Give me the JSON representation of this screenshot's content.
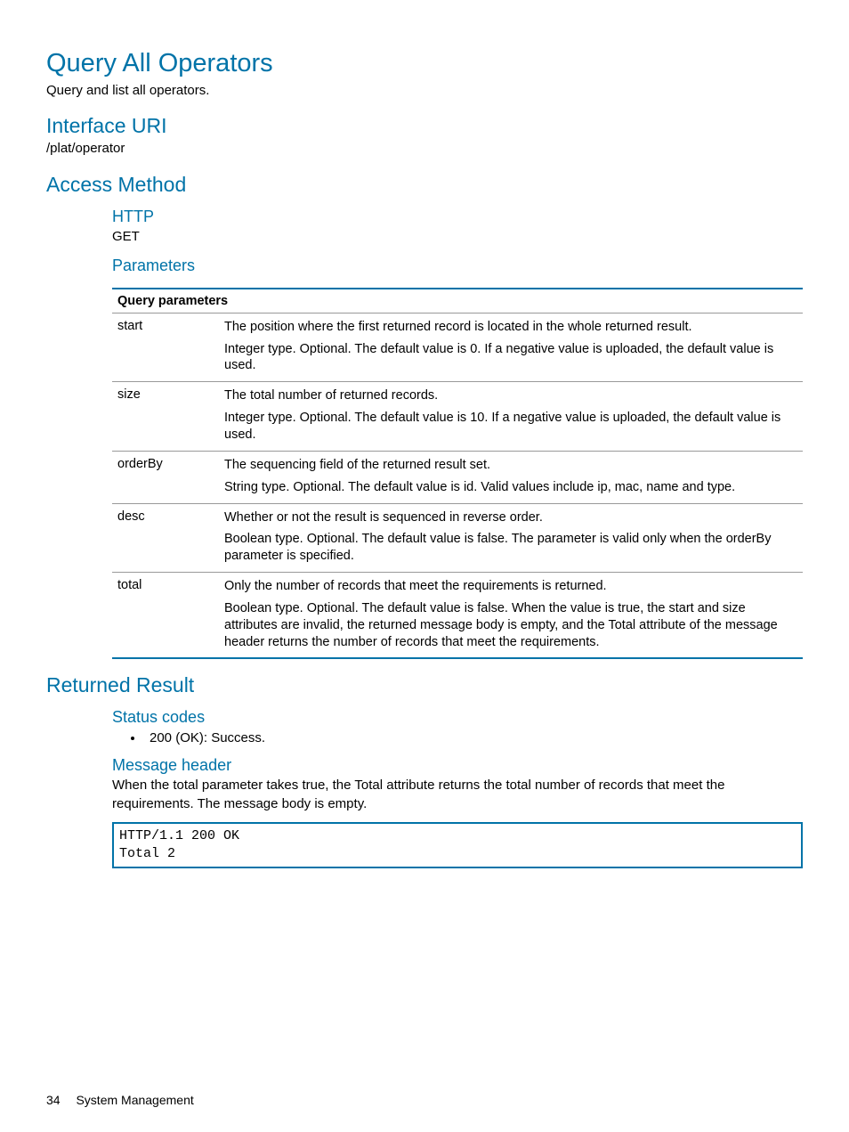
{
  "title": "Query All Operators",
  "intro": "Query and list all operators.",
  "sections": {
    "interface_uri": {
      "heading": "Interface URI",
      "value": "/plat/operator"
    },
    "access_method": {
      "heading": "Access Method",
      "http_heading": "HTTP",
      "http_method": "GET",
      "parameters_heading": "Parameters",
      "table_header": "Query parameters",
      "params": [
        {
          "name": "start",
          "line1": "The position where the first returned record is located in the whole returned result.",
          "line2": "Integer type. Optional. The default value is 0. If a negative value is uploaded, the default value is used."
        },
        {
          "name": "size",
          "line1": "The total number of returned records.",
          "line2": "Integer type. Optional. The default value is 10. If a negative value is uploaded, the default value is used."
        },
        {
          "name": "orderBy",
          "line1": "The sequencing field of the returned result set.",
          "line2": "String type. Optional. The default value is id. Valid values include ip, mac, name and type."
        },
        {
          "name": "desc",
          "line1": "Whether or not the result is sequenced in reverse order.",
          "line2": "Boolean type. Optional. The default value is false. The parameter is valid only when the orderBy parameter is specified."
        },
        {
          "name": "total",
          "line1": "Only the number of records that meet the requirements is returned.",
          "line2": "Boolean type. Optional. The default value is false. When the value is true, the start and size attributes are invalid, the returned message body is empty, and the Total attribute of the message header returns the number of records that meet the requirements."
        }
      ]
    },
    "returned_result": {
      "heading": "Returned Result",
      "status_codes_heading": "Status codes",
      "status_codes": [
        "200 (OK): Success."
      ],
      "message_header_heading": "Message header",
      "message_header_text": "When the total parameter takes true, the Total attribute returns the total number of records that meet the requirements. The message body is empty.",
      "code": "HTTP/1.1 200 OK\nTotal 2"
    }
  },
  "footer": {
    "page_number": "34",
    "section": "System Management"
  }
}
